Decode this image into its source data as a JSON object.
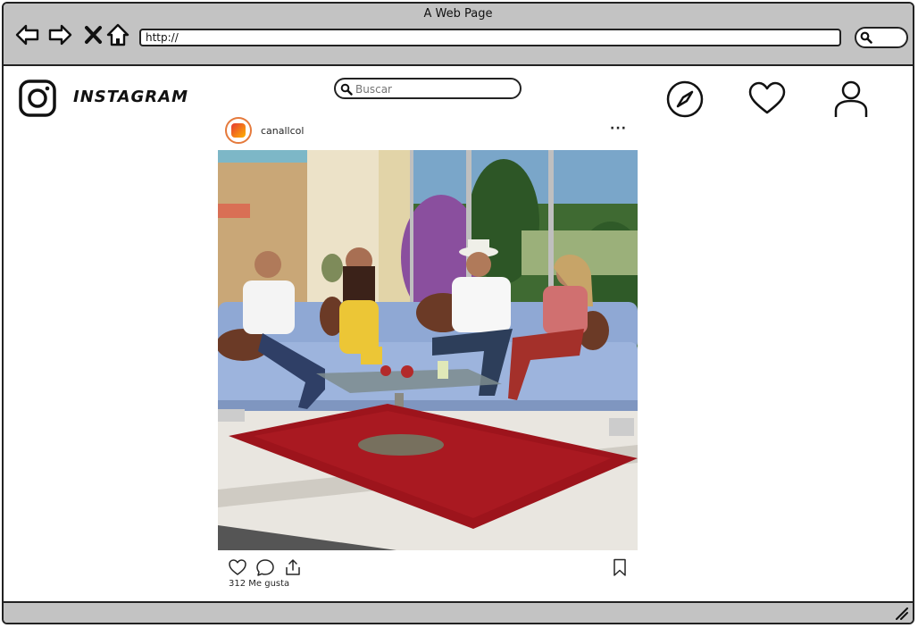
{
  "window": {
    "title": "A Web Page"
  },
  "browser": {
    "url": "http://"
  },
  "header": {
    "wordmark": "INSTAGRAM",
    "search": {
      "placeholder": "Buscar",
      "value": ""
    },
    "icons": [
      "compass-icon",
      "heart-icon",
      "profile-icon"
    ]
  },
  "post": {
    "username": "canallcol",
    "more_label": "···",
    "likes": "312 Me gusta",
    "action_icons": [
      "heart-icon",
      "comment-icon",
      "share-icon",
      "bookmark-icon"
    ]
  }
}
